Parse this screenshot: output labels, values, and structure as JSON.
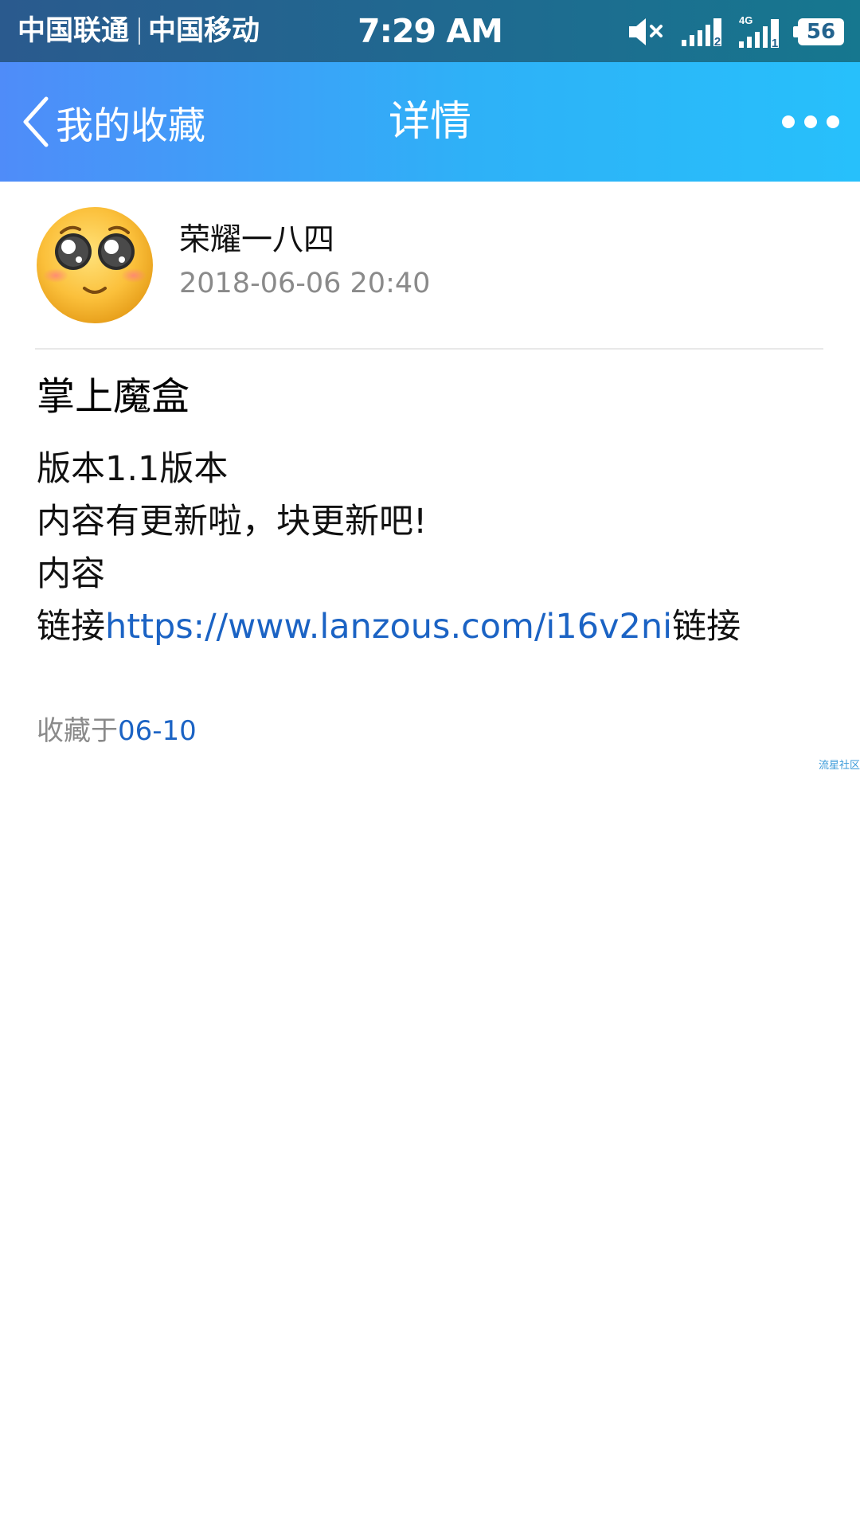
{
  "status_bar": {
    "carrier_1": "中国联通",
    "carrier_2": "中国移动",
    "time": "7:29 AM",
    "battery": "56",
    "sim_1_label": "2",
    "sim_2_label": "1",
    "network_type": "4G",
    "icons": [
      "mute-icon",
      "signal-icon",
      "signal-4g-icon",
      "battery-icon"
    ]
  },
  "header": {
    "back_label": "我的收藏",
    "title": "详情",
    "icons": [
      "back-chevron-icon",
      "more-dots-icon"
    ]
  },
  "post": {
    "author": "荣耀一八四",
    "timestamp": "2018-06-06 20:40",
    "title": "掌上魔盒",
    "line_1": "版本1.1版本",
    "line_2": "内容有更新啦，块更新吧!",
    "line_3": "内容",
    "line_4_prefix": "链接",
    "link": "https://www.lanzous.com/i16v2ni",
    "line_4_suffix": "链接"
  },
  "favorite": {
    "label": "收藏于",
    "date": "06-10"
  },
  "watermark": "流星社区",
  "colors": {
    "status_bar": "#1f6a90",
    "title_bar_start": "#4f8cf9",
    "title_bar_end": "#27c0fb",
    "link": "#1b63c4",
    "muted_text": "#8a8a8a"
  }
}
